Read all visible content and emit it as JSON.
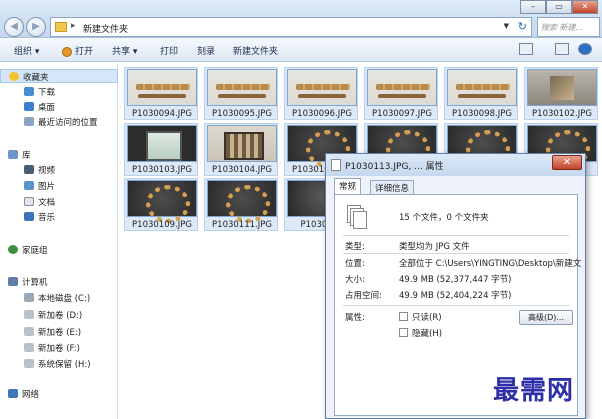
{
  "window": {
    "address_path": "新建文件夹",
    "search_placeholder": "搜索 新建..."
  },
  "toolbar": {
    "organize": "组织 ▾",
    "open": "打开",
    "share": "共享 ▾",
    "print": "打印",
    "burn": "刻录",
    "new_folder": "新建文件夹"
  },
  "sidebar": {
    "favorites": "收藏夹",
    "downloads": "下载",
    "desktop": "桌面",
    "recent": "最近访问的位置",
    "libraries": "库",
    "videos": "视频",
    "pictures": "图片",
    "documents": "文档",
    "music": "音乐",
    "homegroup": "家庭组",
    "computer": "计算机",
    "local_disk": "本地磁盘 (C:)",
    "vol_d": "新加卷 (D:)",
    "vol_e": "新加卷 (E:)",
    "vol_f": "新加卷 (F:)",
    "reserved": "系统保留 (H:)",
    "network": "网络"
  },
  "files": [
    {
      "name": "P1030094.JPG",
      "thumb": "sticks"
    },
    {
      "name": "P1030095.JPG",
      "thumb": "sticks"
    },
    {
      "name": "P1030096.JPG",
      "thumb": "sticks"
    },
    {
      "name": "P1030097.JPG",
      "thumb": "sticks"
    },
    {
      "name": "P1030098.JPG",
      "thumb": "sticks"
    },
    {
      "name": "P1030102.JPG",
      "thumb": "cube"
    },
    {
      "name": "P1030103.JPG",
      "thumb": "screen"
    },
    {
      "name": "P1030104.JPG",
      "thumb": "box"
    },
    {
      "name": "P1030105.JPG",
      "thumb": "ring"
    },
    {
      "name": "",
      "thumb": "ring"
    },
    {
      "name": "",
      "thumb": "ring"
    },
    {
      "name": "",
      "thumb": "ring"
    },
    {
      "name": "P1030109.JPG",
      "thumb": "ring"
    },
    {
      "name": "P1030111.JPG",
      "thumb": "ring"
    },
    {
      "name": "P1030111",
      "thumb": "dark"
    }
  ],
  "dialog": {
    "title": "P1030113.JPG, ... 属性",
    "close": "✕",
    "tab_general": "常规",
    "tab_details": "详细信息",
    "summary": "15 个文件，0 个文件夹",
    "type_label": "类型:",
    "type_value": "类型均为 JPG 文件",
    "location_label": "位置:",
    "location_value": "全部位于 C:\\Users\\YINGTING\\Desktop\\新建文",
    "size_label": "大小:",
    "size_value": "49.9 MB (52,377,447 字节)",
    "disk_label": "占用空间:",
    "disk_value": "49.9 MB (52,404,224 字节)",
    "attr_label": "属性:",
    "readonly": "只读(R)",
    "hidden": "隐藏(H)",
    "advanced": "高级(D)..."
  },
  "watermark": "最需网",
  "colors": {
    "accent": "#2e2ea8",
    "selection": "#d5e6f9",
    "close_button": "#c2432a"
  }
}
